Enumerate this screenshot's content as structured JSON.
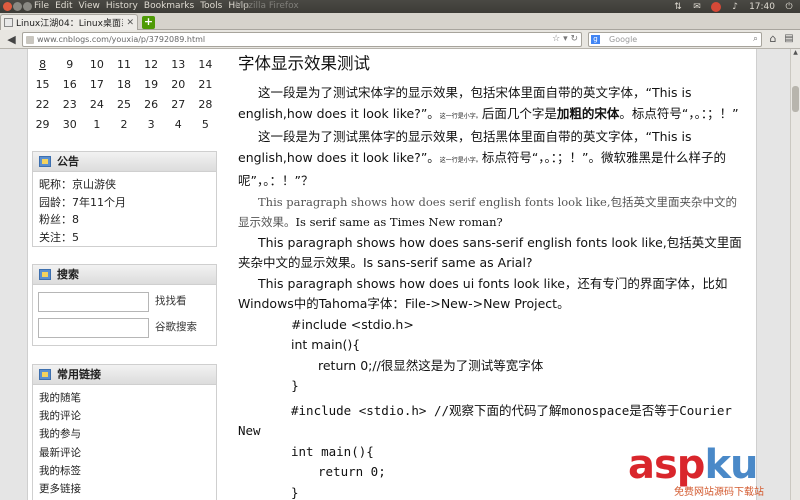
{
  "top_panel": {
    "menu": [
      "File",
      "Edit",
      "View",
      "History",
      "Bookmarks",
      "Tools",
      "Help"
    ],
    "window_title": "Mozilla Firefox",
    "clock": "17:40"
  },
  "browser": {
    "tab_title": "Linux江湖04：Linux桌面系统...",
    "url": "www.cnblogs.com/youxia/p/3792089.html",
    "search_placeholder": "Google",
    "search_engine_letter": "g"
  },
  "calendar": {
    "rows": [
      [
        "8",
        "9",
        "10",
        "11",
        "12",
        "13",
        "14"
      ],
      [
        "15",
        "16",
        "17",
        "18",
        "19",
        "20",
        "21"
      ],
      [
        "22",
        "23",
        "24",
        "25",
        "26",
        "27",
        "28"
      ],
      [
        "29",
        "30",
        "1",
        "2",
        "3",
        "4",
        "5"
      ]
    ]
  },
  "notice": {
    "title": "公告",
    "lines": [
      "昵称：京山游侠",
      "园龄：7年11个月",
      "粉丝：8",
      "关注：5"
    ]
  },
  "search_box": {
    "title": "搜索",
    "find_label": "找找看",
    "google_label": "谷歌搜索"
  },
  "links": {
    "title": "常用链接",
    "items": [
      "我的随笔",
      "我的评论",
      "我的参与",
      "最新评论",
      "我的标签",
      "更多链接"
    ]
  },
  "article": {
    "title": "字体显示效果测试",
    "p1_a": "这一段是为了测试宋体字的显示效果，包括宋体里面自带的英文字体，“This is english,how does it look like?”。",
    "p1_small": "这一行是小字。",
    "p1_b": "后面几个字是",
    "p1_bold": "加粗的宋体",
    "p1_c": "。标点符号“，。：；！”",
    "p2_a": "这一段是为了测试黑体字的显示效果，包括黑体里面自带的英文字体，“This is english,how does it look like?”。",
    "p2_small": "这一行是小字。",
    "p2_b": "标点符号“，。：；！”。微软雅黑是什么样子的呢”，。：！”？",
    "p3_a": "This paragraph shows how does serif english fonts look like,包括英文里面夹杂中文的显示效果。",
    "p3_b": "Is serif same as Times New roman?",
    "p4": "This paragraph shows how does sans-serif english fonts look like,包括英文里面夹杂中文的显示效果。Is sans-serif same as Arial?",
    "p5": "This paragraph shows how does ui fonts look like，还有专门的界面字体，比如Windows中的Tahoma字体：File->New->New Project。",
    "code1": [
      "#include <stdio.h>",
      "int main(){",
      "return 0;//很显然这是为了测试等宽字体",
      "}"
    ],
    "code2_line1": "#include <stdio.h>    //观察下面的代码了解monospace是否等于Courier New",
    "code2": [
      "int main(){",
      "return 0;",
      "}"
    ]
  },
  "watermark": {
    "main_a": "asp",
    "main_b": "ku",
    "sub": "免费网站源码下载站"
  }
}
